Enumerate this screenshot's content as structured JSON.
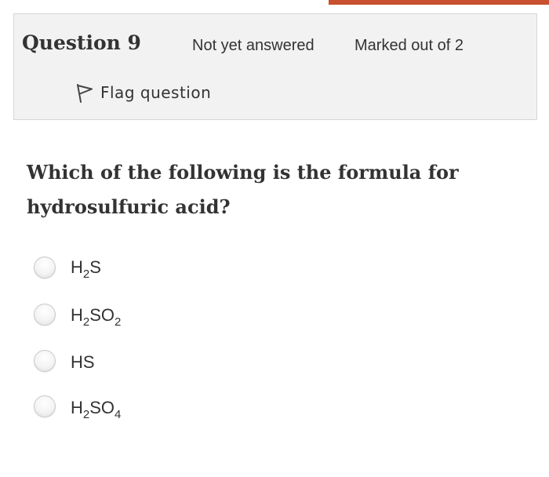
{
  "question": {
    "number_label": "Question 9",
    "state": "Not yet answered",
    "grade": "Marked out of 2",
    "flag_label": "Flag question",
    "text": "Which of the following is the formula for hydrosulfuric acid?"
  },
  "answers": [
    {
      "parts": [
        "H",
        "2",
        "S"
      ]
    },
    {
      "parts": [
        "H",
        "2",
        "SO",
        "2"
      ]
    },
    {
      "parts": [
        "HS"
      ]
    },
    {
      "parts": [
        "H",
        "2",
        "SO",
        "4"
      ]
    }
  ],
  "colors": {
    "accent": "#c8502e",
    "info_background": "#f2f2f2",
    "text": "#333333"
  },
  "icons": {
    "flag": "flag-icon",
    "radio": "radio-icon"
  }
}
